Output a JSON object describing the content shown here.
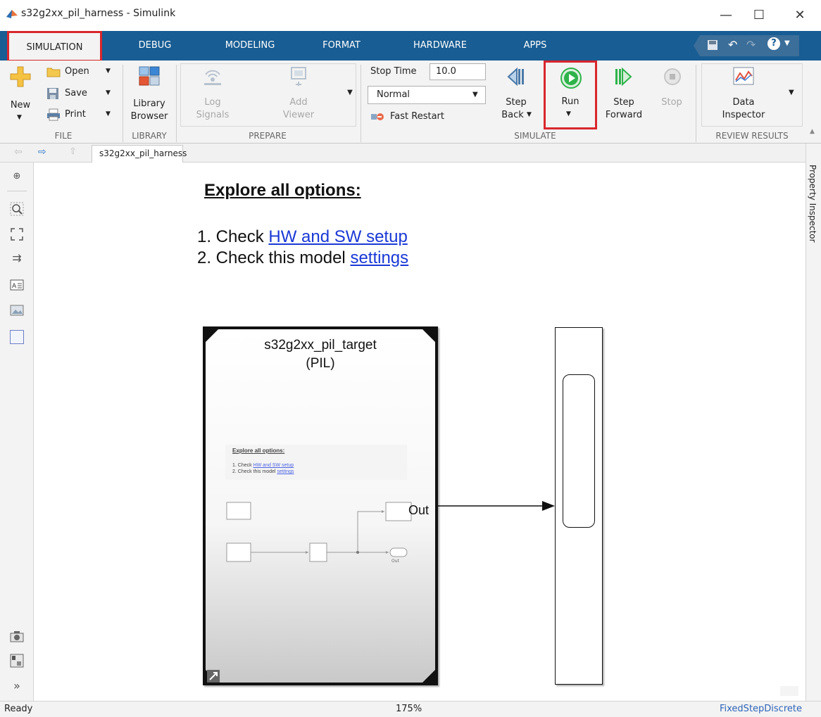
{
  "window": {
    "title": "s32g2xx_pil_harness - Simulink",
    "minimize": "—",
    "maximize": "☐",
    "close": "✕"
  },
  "tabs": [
    {
      "label": "SIMULATION"
    },
    {
      "label": "DEBUG"
    },
    {
      "label": "MODELING"
    },
    {
      "label": "FORMAT"
    },
    {
      "label": "HARDWARE"
    },
    {
      "label": "APPS"
    }
  ],
  "ribbon": {
    "file": {
      "group_label": "FILE",
      "new_label": "New",
      "open_label": "Open",
      "save_label": "Save",
      "print_label": "Print"
    },
    "library": {
      "group_label": "LIBRARY",
      "browser_label_1": "Library",
      "browser_label_2": "Browser"
    },
    "prepare": {
      "group_label": "PREPARE",
      "log_label_1": "Log",
      "log_label_2": "Signals",
      "add_label_1": "Add",
      "add_label_2": "Viewer"
    },
    "simulate": {
      "group_label": "SIMULATE",
      "stop_time_label": "Stop Time",
      "stop_time_value": "10.0",
      "mode_value": "Normal",
      "fast_restart_label": "Fast Restart",
      "step_back_1": "Step",
      "step_back_2": "Back",
      "run_label": "Run",
      "step_forward_1": "Step",
      "step_forward_2": "Forward",
      "stop_label": "Stop"
    },
    "review": {
      "group_label": "REVIEW RESULTS",
      "data_label_1": "Data",
      "data_label_2": "Inspector"
    }
  },
  "doc_tab": "s32g2xx_pil_harness",
  "property_inspector": "Property Inspector",
  "canvas": {
    "heading": "Explore all options:",
    "line1_prefix": "1. Check ",
    "line1_link": "HW and SW setup",
    "line2_prefix": "2. Check this model ",
    "line2_link": "settings",
    "block_name_1": "s32g2xx_pil_target",
    "block_name_2": "(PIL)",
    "port_label": "Out",
    "thumb_heading": "Explore all options:",
    "thumb_line1_prefix": "1. Check ",
    "thumb_line1_link": "HW and SW setup",
    "thumb_line2_prefix": "2. Check this model ",
    "thumb_line2_link": "settings",
    "thumb_out": "Out"
  },
  "status": {
    "left": "Ready",
    "zoom": "175%",
    "solver": "FixedStepDiscrete"
  },
  "colors": {
    "tab_bar": "#185d93",
    "highlight": "#d9262d",
    "run_green": "#2eb34a",
    "link": "#1a38d6"
  }
}
